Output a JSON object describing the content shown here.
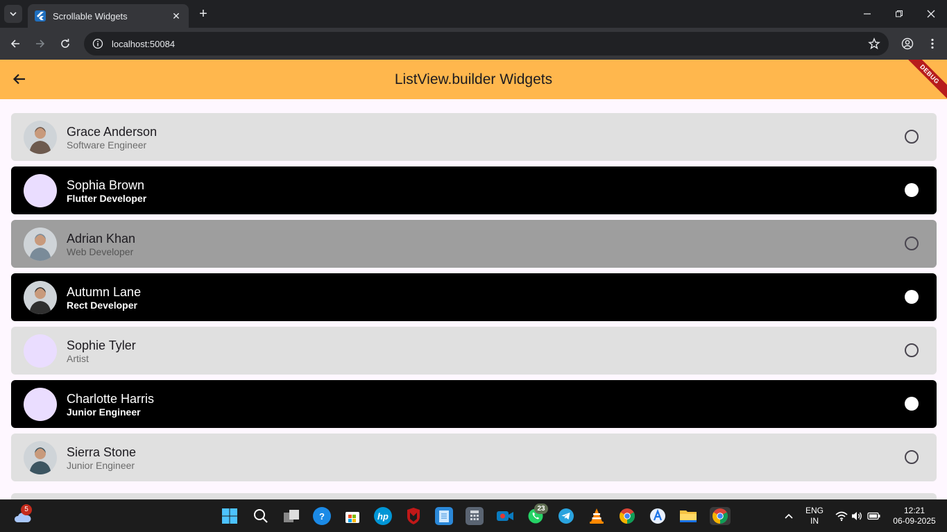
{
  "browser": {
    "tab_title": "Scrollable Widgets",
    "new_tab": "+",
    "close_tab": "✕",
    "url": "localhost:50084"
  },
  "app": {
    "title": "ListView.builder Widgets",
    "debug_banner": "DEBUG",
    "accent_color": "#ffb74d"
  },
  "items": [
    {
      "name": "Grace Anderson",
      "role": "Software Engineer",
      "selected": false
    },
    {
      "name": "Sophia Brown",
      "role": "Flutter Developer",
      "selected": true
    },
    {
      "name": "Adrian Khan",
      "role": "Web Developer",
      "selected": false
    },
    {
      "name": "Autumn Lane",
      "role": "Rect Developer",
      "selected": true
    },
    {
      "name": "Sophie Tyler",
      "role": "Artist",
      "selected": false
    },
    {
      "name": "Charlotte Harris",
      "role": "Junior Engineer",
      "selected": true
    },
    {
      "name": "Sierra Stone",
      "role": "Junior Engineer",
      "selected": false
    }
  ],
  "taskbar": {
    "weather_badge": "5",
    "whatsapp_badge": "23",
    "lang_line1": "ENG",
    "lang_line2": "IN",
    "time": "12:21",
    "date": "06-09-2025"
  }
}
